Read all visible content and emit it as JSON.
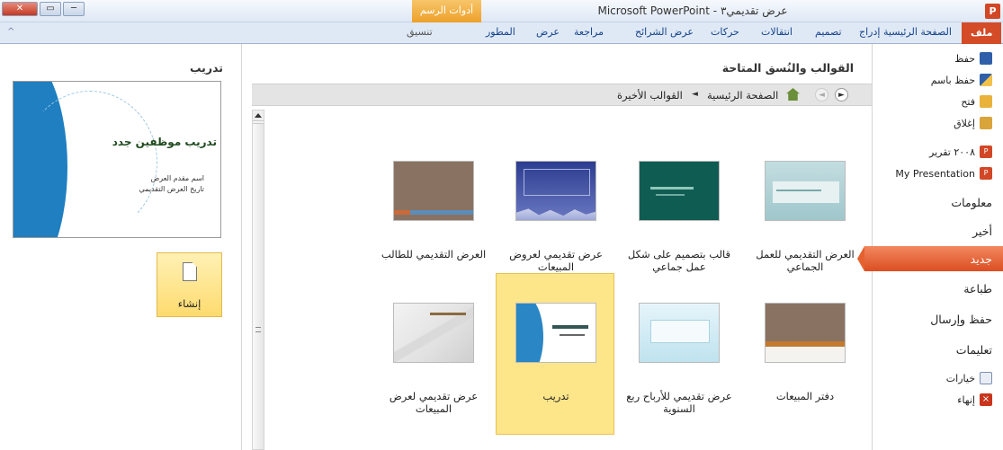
{
  "window": {
    "title": "عرض تقديمي٣ - Microsoft PowerPoint",
    "context_tab": "أدوات الرسم",
    "app_icon": "P",
    "controls": [
      "▭",
      "─",
      "✕"
    ]
  },
  "ribbon_tabs": {
    "file": "ملف",
    "home": "الصفحة الرئيسية",
    "insert": "إدراج",
    "design": "تصميم",
    "transitions": "انتقالات",
    "animations": "حركات",
    "slideshow": "عرض الشرائح",
    "review": "مراجعة",
    "view": "عرض",
    "developer": "المطور",
    "format": "تنسيق",
    "collapse_icon": "^"
  },
  "nav": {
    "save": "حفظ",
    "save_as": "حفظ باسم",
    "open": "فتح",
    "close": "إغلاق",
    "recent1": "٢٠٠٨ تقرير",
    "recent2": "My Presentation",
    "info": "معلومات",
    "recent": "أخير",
    "new": "جديد",
    "print": "طباعة",
    "save_send": "حفظ وإرسال",
    "help": "تعليمات",
    "options": "خيارات",
    "exit": "إنهاء"
  },
  "main": {
    "title": "القوالب والنُسق المتاحة",
    "breadcrumb": {
      "home": "الصفحة الرئيسية",
      "current": "القوالب الأخيرة"
    },
    "templates": [
      {
        "label": "العرض التقديمي للعمل الجماعي",
        "style": "teal-light"
      },
      {
        "label": "قالب بتصميم على شكل عمل جماعي",
        "style": "green"
      },
      {
        "label": "عرض تقديمي لعروض المبيعات",
        "style": "blue"
      },
      {
        "label": "العرض التقديمي للطالب",
        "style": "brown"
      },
      {
        "label": "دفتر المبيعات",
        "style": "brown2"
      },
      {
        "label": "عرض تقديمي للأرباح ربع السنوية",
        "style": "sky"
      },
      {
        "label": "تدريب",
        "style": "wave",
        "selected": true
      },
      {
        "label": "عرض تقديمي لعرض المبيعات",
        "style": "grey"
      }
    ]
  },
  "preview": {
    "title": "تدريب",
    "slide_heading": "تدريب موظفين جدد",
    "slide_sub1": "اسم مقدم العرض",
    "slide_sub2": "تاريخ العرض التقديمي",
    "create_label": "إنشاء"
  },
  "colors": {
    "accent": "#d44b27",
    "selected": "#fde58a",
    "ribbon": "#dfe9f5"
  }
}
